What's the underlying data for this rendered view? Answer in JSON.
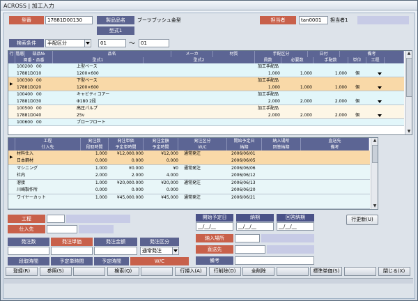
{
  "window": {
    "title": "ACROSS | 加工入力"
  },
  "header": {
    "model_label": "型番",
    "model_value": "17881D00130",
    "product_label": "製品品名",
    "product_value": "ブーツブッシュ金型",
    "type1_label": "型式1",
    "person_label": "担当者",
    "person_code": "tan0001",
    "person_name": "担当者1"
  },
  "search": {
    "label": "検索条件",
    "select_value": "手配区分",
    "from_value": "01",
    "tilde": "～",
    "to_value": "01"
  },
  "top_grid": {
    "headers_row1": [
      "行",
      "階層",
      "部品№",
      "品名",
      "メーカ",
      "材質",
      "手配区分",
      "日付",
      "備考"
    ],
    "headers_row2": [
      "図番・品番",
      "型式1",
      "型式2",
      "員数",
      "必要数",
      "手配数",
      "単位",
      "工程"
    ],
    "rows": [
      {
        "line1": [
          "100200",
          "00",
          "",
          "上型ベース",
          "",
          "",
          "加工手配品"
        ],
        "line2": [
          "17881D010",
          "1200×600",
          "",
          "1.000",
          "1.000",
          "1.000",
          "個"
        ]
      },
      {
        "line1": [
          "100300",
          "00",
          "",
          "下型ベース",
          "",
          "",
          "加工手配品"
        ],
        "line2": [
          "17881D020",
          "1200×600",
          "",
          "1.000",
          "1.000",
          "1.000",
          "個"
        ]
      },
      {
        "line1": [
          "100400",
          "00",
          "",
          "キャビティコアー",
          "",
          "",
          "加工手配品"
        ],
        "line2": [
          "17881D030",
          "Φ180 2段",
          "",
          "2.000",
          "2.000",
          "2.000",
          "個"
        ]
      },
      {
        "line1": [
          "100500",
          "00",
          "",
          "高圧パルプ",
          "",
          "",
          "加工手配品"
        ],
        "line2": [
          "17881D040",
          "25v",
          "",
          "2.000",
          "2.000",
          "2.000",
          "個"
        ]
      },
      {
        "line1": [
          "100600",
          "00",
          "",
          "ブローフロート",
          "",
          "",
          ""
        ],
        "line2": []
      }
    ]
  },
  "mid_grid": {
    "headers_row1": [
      "工程",
      "発注数",
      "発注単価",
      "発注金額",
      "発注区分",
      "開始予定日",
      "納入場所",
      "直送先"
    ],
    "headers_row2": [
      "仕入先",
      "段取時間",
      "予定単時間",
      "予定時間",
      "W/C",
      "納期",
      "回答納期",
      "備考"
    ],
    "rows": [
      {
        "line1": [
          "材料仕入",
          "1.000",
          "¥12,000.000",
          "¥12,000",
          "通常発注",
          "2006/06/01"
        ],
        "line2": [
          "日本鋼材",
          "0.000",
          "0.000",
          "0.000",
          "",
          "2006/06/05"
        ]
      },
      {
        "line1": [
          "マシニング",
          "1.000",
          "¥0.000",
          "¥0",
          "通常発注",
          "2006/06/06"
        ],
        "line2": [
          "社内",
          "2.000",
          "2.000",
          "4.000",
          "",
          "2006/06/12"
        ]
      },
      {
        "line1": [
          "溶接",
          "1.000",
          "¥20,000.000",
          "¥20,000",
          "通常発注",
          "2006/06/13"
        ],
        "line2": [
          "川崎製作所",
          "0.000",
          "0.000",
          "0.000",
          "",
          "2006/06/20"
        ]
      },
      {
        "line1": [
          "ワイヤーカット",
          "1.000",
          "¥45,000.000",
          "¥45,000",
          "通常発注",
          "2006/06/21"
        ],
        "line2": [
          "",
          "",
          "",
          "",
          "",
          ""
        ]
      }
    ]
  },
  "detail": {
    "process_label": "工程",
    "supplier_label": "仕入先",
    "qty_label": "発注数",
    "unit_price_label": "発注単価",
    "amount_label": "発注金額",
    "order_type_label": "発注区分",
    "order_type_value": "通常発注",
    "setup_label": "段取時間",
    "plan_unit_label": "予定単時間",
    "plan_time_label": "予定時間",
    "wc_label": "W/C",
    "start_label": "開始予定日",
    "due_label": "納期",
    "reply_label": "回答納期",
    "date_placeholder": "__/__/__",
    "place_label": "納入場所",
    "direct_label": "直送先",
    "note_label": "備考",
    "row_update_button": "行更新(U)"
  },
  "function_keys": [
    "登録(R)",
    "参照(S)",
    "",
    "検索(Q)",
    "",
    "行挿入(A)",
    "行削除(D)",
    "全削除",
    "",
    "標準単価(S)",
    "",
    "閉じる(X)"
  ],
  "colors": {
    "accent_red": "#c8604a",
    "header_blue": "#5c6594",
    "row_orange": "#f9d9a8",
    "row_cyan": "#e2f6fa"
  }
}
